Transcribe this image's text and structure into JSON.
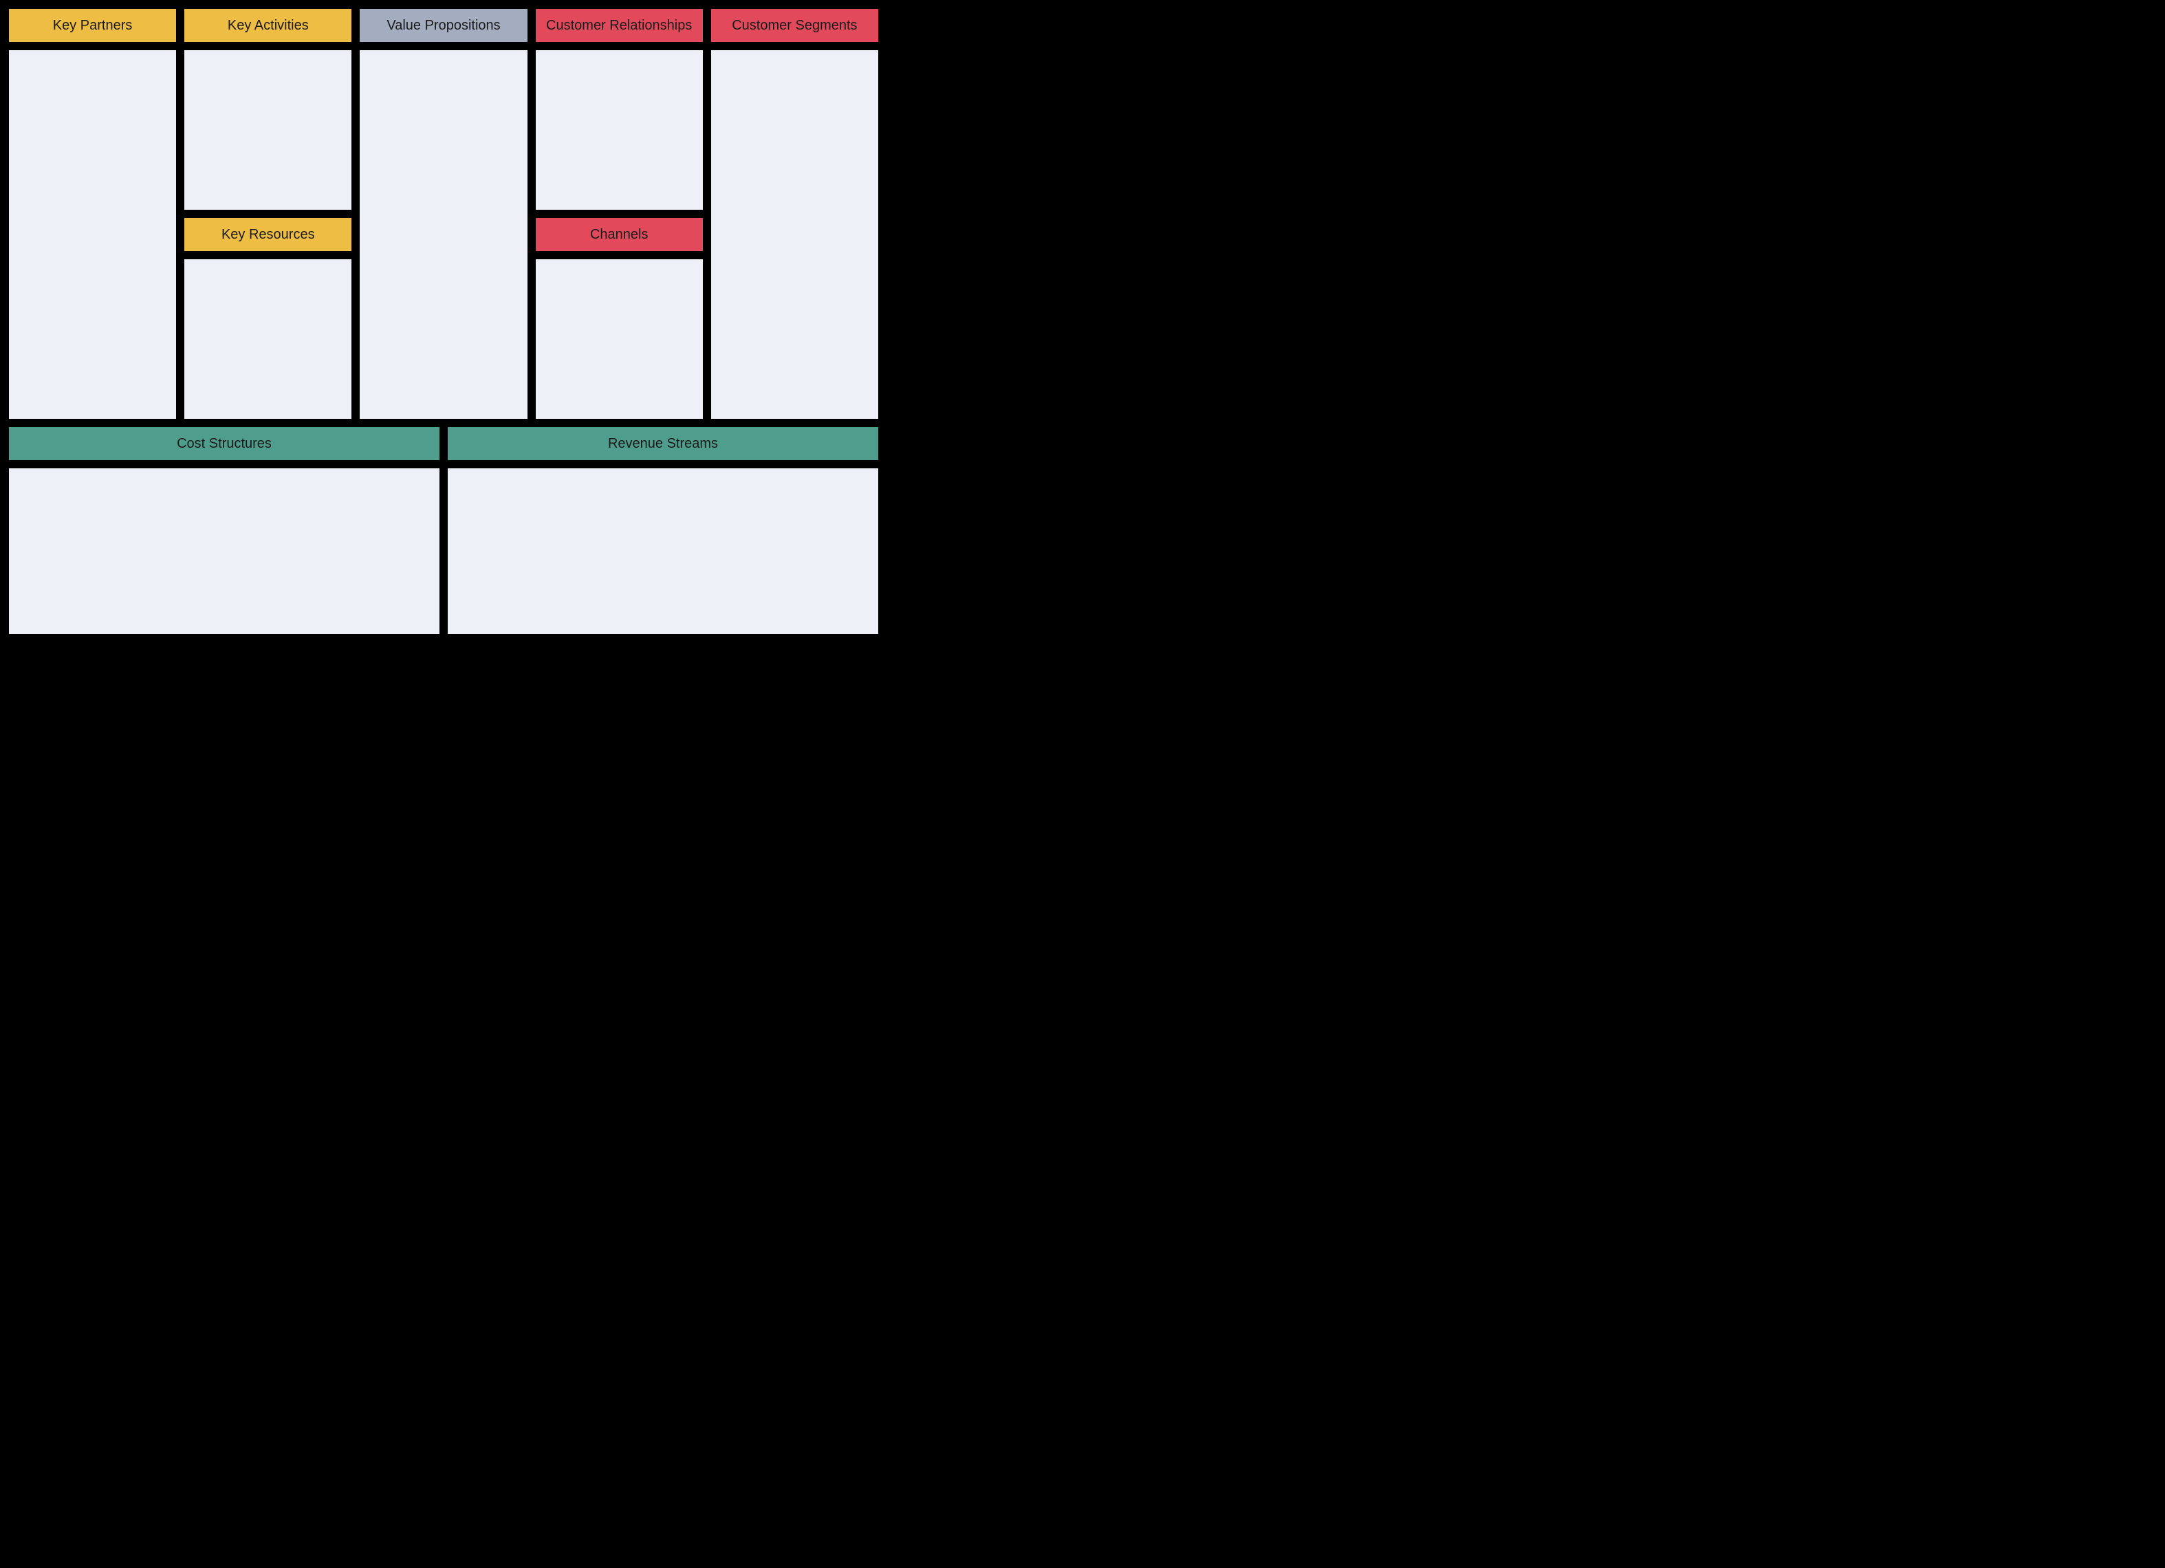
{
  "headers": {
    "key_partners": "Key Partners",
    "key_activities": "Key Activities",
    "key_resources": "Key Resources",
    "value_propositions": "Value Propositions",
    "customer_relationships": "Customer Relationships",
    "channels": "Channels",
    "customer_segments": "Customer Segments",
    "cost_structures": "Cost Structures",
    "revenue_streams": "Revenue Streams"
  },
  "colors": {
    "yellow": "#eebd44",
    "blue": "#a3adbf",
    "pink": "#e2495b",
    "teal": "#4f9d8d",
    "content_bg": "#edf1f7",
    "border": "#000000",
    "page_bg": "#000000"
  }
}
